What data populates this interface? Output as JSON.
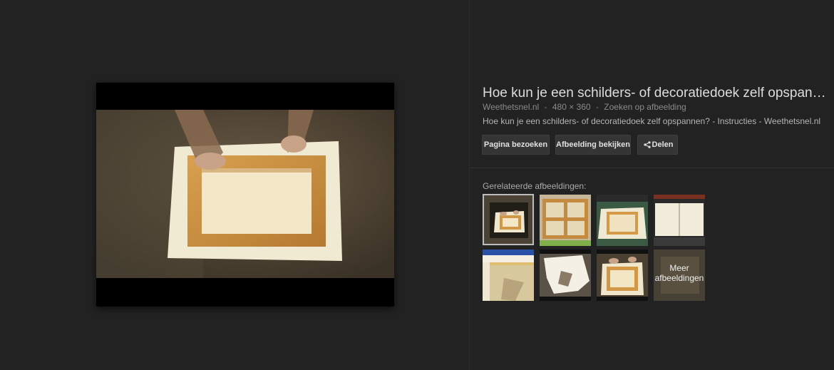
{
  "result": {
    "title": "Hoe kun je een schilders- of decoratiedoek zelf opspannen? - Instructies - Weethetsnel.nl",
    "site": "Weethetsnel.nl",
    "separator": "-",
    "dimensions": "480 × 360",
    "search_by_image": "Zoeken op afbeelding",
    "description": "Hoe kun je een schilders- of decoratiedoek zelf opspannen? - Instructies - Weethetsnel.nl"
  },
  "buttons": {
    "visit_page": "Pagina bezoeken",
    "view_image": "Afbeelding bekijken",
    "share": "Delen"
  },
  "related": {
    "label": "Gerelateerde afbeeldingen:",
    "more_line1": "Meer",
    "more_line2": "afbeeldingen"
  },
  "icons": {
    "share": "share-icon"
  },
  "colors": {
    "background": "#222222",
    "button_bg": "#353535",
    "title_text": "#dddddd"
  }
}
